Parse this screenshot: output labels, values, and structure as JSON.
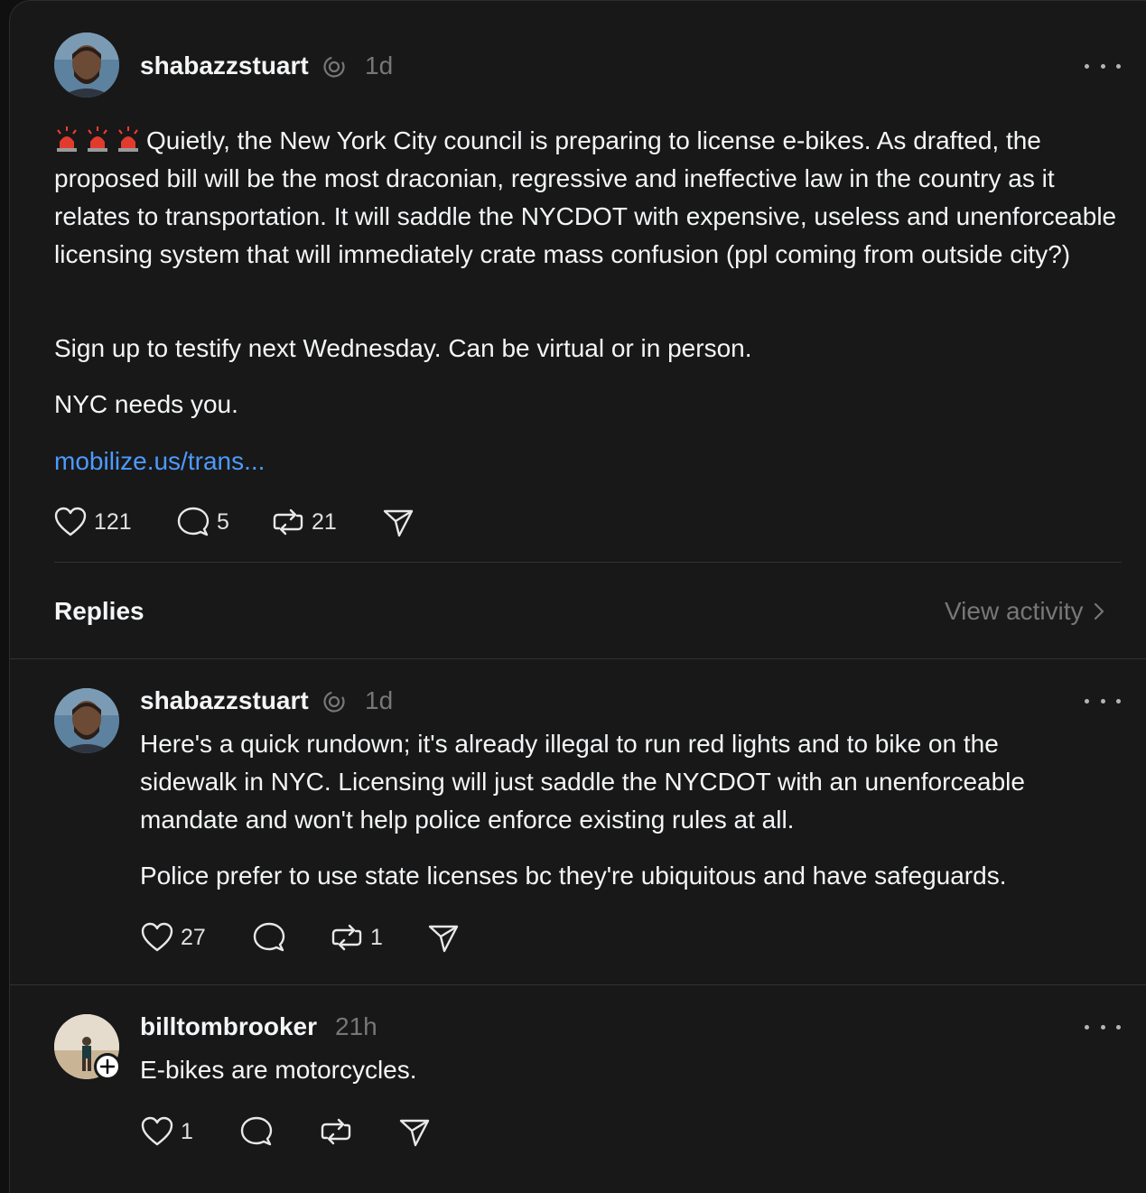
{
  "post": {
    "username": "shabazzstuart",
    "time": "1d",
    "paragraphs": [
      "Quietly, the New York City council is preparing to license e-bikes. As drafted, the proposed bill will be the most draconian, regressive and ineffective law in the country as it relates to transportation. It will saddle the NYCDOT with expensive, useless and unenforceable licensing system that will immediately crate mass confusion (ppl coming from outside city?)",
      "Sign up to testify next Wednesday. Can be virtual or in person.",
      "NYC needs you."
    ],
    "link": "mobilize.us/trans...",
    "likes": "121",
    "replies": "5",
    "reposts": "21"
  },
  "replies_header": {
    "label": "Replies",
    "view_activity": "View activity"
  },
  "reply1": {
    "username": "shabazzstuart",
    "time": "1d",
    "paragraphs": [
      "Here's a quick rundown; it's already illegal to run red lights and to bike on the sidewalk in NYC. Licensing will just saddle the NYCDOT with an unenforceable mandate and won't help police enforce existing rules at all.",
      "Police prefer to use state licenses bc they're ubiquitous and have safeguards."
    ],
    "likes": "27",
    "reposts": "1"
  },
  "reply2": {
    "username": "billtombrooker",
    "time": "21h",
    "text": "E-bikes are motorcycles.",
    "likes": "1"
  },
  "icons": {
    "siren": "police-siren-emoji",
    "verified": "threads-icon",
    "like": "heart-icon",
    "reply": "speech-bubble-icon",
    "repost": "repost-icon",
    "share": "send-icon",
    "more": "ellipsis-icon"
  }
}
